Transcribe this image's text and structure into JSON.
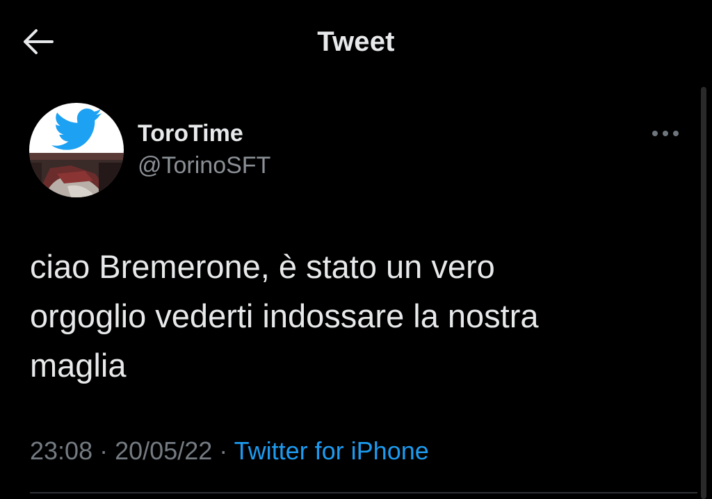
{
  "header": {
    "title": "Tweet",
    "back_icon": "arrow-left-icon"
  },
  "tweet": {
    "author": {
      "display_name": "ToroTime",
      "handle": "@TorinoSFT",
      "avatar_icon": "twitter-bird-icon"
    },
    "more_icon": "more-horizontal-icon",
    "text": "ciao Bremerone, è stato un vero\norgoglio vederti indossare la nostra\nmaglia",
    "time": "23:08",
    "separator": "·",
    "date": "20/05/22",
    "source": "Twitter for iPhone"
  },
  "colors": {
    "background": "#000000",
    "text": "#e7e9ea",
    "secondary_text": "#8b9096",
    "link": "#1d9bf0",
    "twitter_blue": "#1da1f2"
  }
}
